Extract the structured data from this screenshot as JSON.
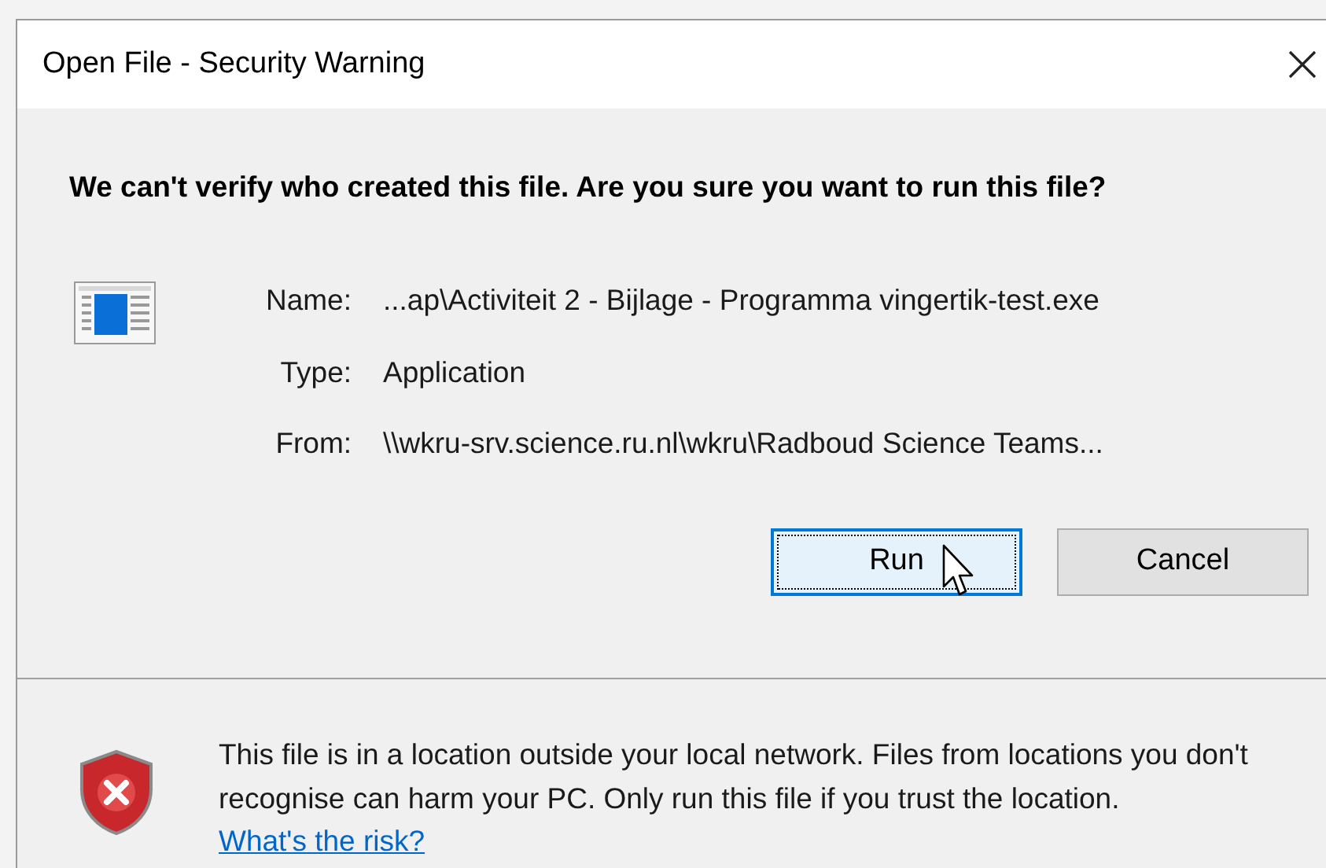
{
  "window": {
    "title": "Open File - Security Warning"
  },
  "heading": "We can't verify who created this file. Are you sure you want to run this file?",
  "details": [
    {
      "label": "Name:",
      "value": "...ap\\Activiteit 2 - Bijlage - Programma vingertik-test.exe"
    },
    {
      "label": "Type:",
      "value": "Application"
    },
    {
      "label": "From:",
      "value": "\\\\wkru-srv.science.ru.nl\\wkru\\Radboud Science Teams..."
    }
  ],
  "buttons": [
    {
      "label": "Run",
      "focused": true
    },
    {
      "label": "Cancel",
      "focused": false
    }
  ],
  "warning": {
    "text": "This file is in a location outside your local network. Files from locations you don't recognise can harm your PC. Only run this file if you trust the location.",
    "link": "What's the risk?"
  }
}
